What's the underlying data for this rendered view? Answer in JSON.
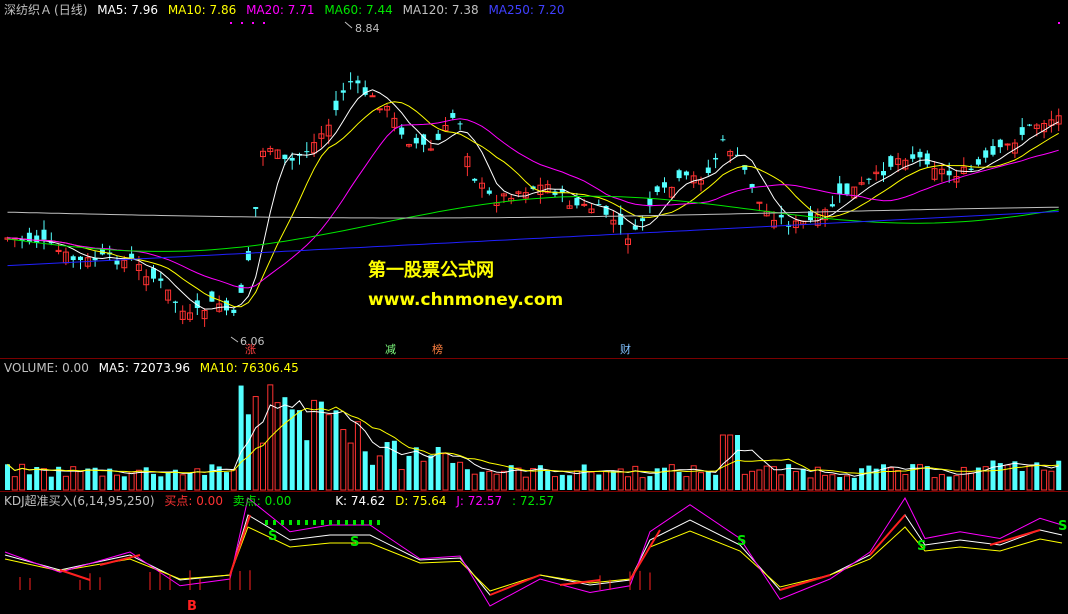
{
  "header_main": {
    "stock": "深纺织Ａ",
    "period": "(日线)",
    "ma5": "MA5: 7.96",
    "ma10": "MA10: 7.86",
    "ma20": "MA20: 7.71",
    "ma60": "MA60: 7.44",
    "ma120": "MA120: 7.38",
    "ma250": "MA250: 7.20"
  },
  "header_volume": {
    "label": "VOLUME: 0.00",
    "ma5": "MA5: 72073.96",
    "ma10": "MA10: 76306.45"
  },
  "header_kdj": {
    "label": "KDJ超准买入(6,14,95,250)",
    "buy": "买点: 0.00",
    "sell": "卖点: 0.00",
    "k": "K: 74.62",
    "d": "D: 75.64",
    "j": "J: 72.57",
    "extra": ": 72.57"
  },
  "annotations": {
    "high": "8.84",
    "low": "6.06"
  },
  "events": [
    "涨",
    "减",
    "榜",
    "财"
  ],
  "kdj_marks": {
    "buy": "B",
    "sell": "S"
  },
  "watermark": {
    "line1": "第一股票公式网",
    "line2": "www.chnmoney.com"
  },
  "colors": {
    "background": "#000000",
    "up": "#ff3232",
    "down": "#54ffff",
    "ma5": "#ffffff",
    "ma10": "#ffff00",
    "ma20": "#ff00ff",
    "ma60": "#00e600",
    "ma120": "#c0c0c0",
    "ma250": "#2020ff",
    "separator": "#7a0000"
  },
  "chart_data": {
    "type": "candlestick",
    "price_range": [
      6.06,
      8.84
    ],
    "series": [
      {
        "name": "MA5",
        "values": [
          7.96
        ]
      },
      {
        "name": "MA10",
        "values": [
          7.86
        ]
      },
      {
        "name": "MA20",
        "values": [
          7.71
        ]
      },
      {
        "name": "MA60",
        "values": [
          7.44
        ]
      },
      {
        "name": "MA120",
        "values": [
          7.38
        ]
      },
      {
        "name": "MA250",
        "values": [
          7.2
        ]
      },
      {
        "name": "VOLUME MA5",
        "values": [
          72073.96
        ]
      },
      {
        "name": "VOLUME MA10",
        "values": [
          76306.45
        ]
      },
      {
        "name": "K",
        "values": [
          74.62
        ]
      },
      {
        "name": "D",
        "values": [
          75.64
        ]
      },
      {
        "name": "J",
        "values": [
          72.57
        ]
      }
    ]
  }
}
